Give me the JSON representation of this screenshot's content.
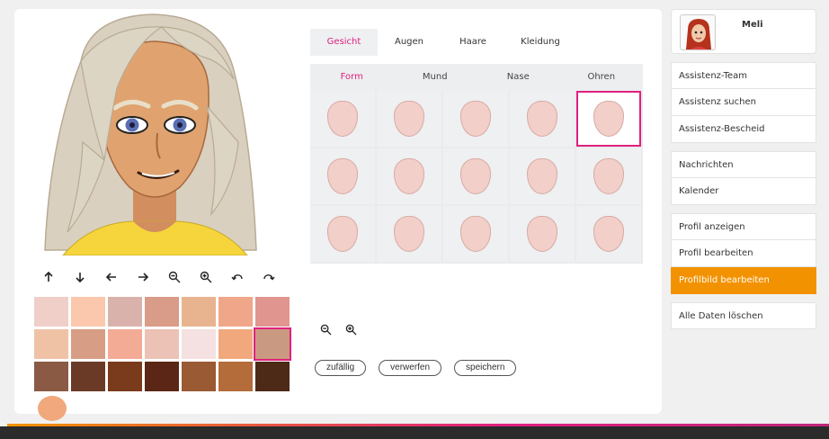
{
  "editor": {
    "tabs": [
      {
        "label": "Gesicht",
        "active": true
      },
      {
        "label": "Augen",
        "active": false
      },
      {
        "label": "Haare",
        "active": false
      },
      {
        "label": "Kleidung",
        "active": false
      }
    ],
    "subtabs": [
      {
        "label": "Form",
        "active": true
      },
      {
        "label": "Mund",
        "active": false
      },
      {
        "label": "Nase",
        "active": false
      },
      {
        "label": "Ohren",
        "active": false
      }
    ],
    "shape_options": 15,
    "selected_shape": 5,
    "actions": {
      "random": "zufällig",
      "discard": "verwerfen",
      "save": "speichern"
    }
  },
  "tools": [
    "arrow-up-icon",
    "arrow-down-icon",
    "arrow-left-icon",
    "arrow-right-icon",
    "zoom-out-icon",
    "zoom-in-icon",
    "undo-icon",
    "redo-icon"
  ],
  "skin_palette": [
    "#f0cfc9",
    "#fbc8ae",
    "#d9b3ab",
    "#d89c89",
    "#e8b48f",
    "#f0a688",
    "#e0968e",
    "#efc2a6",
    "#d79e85",
    "#f3ab95",
    "#ecc2b6",
    "#f5e1e1",
    "#f0a87c",
    "#c99a81",
    "#8a5a44",
    "#6b3a26",
    "#7a3a1c",
    "#5b2615",
    "#9a5a33",
    "#b56c3b",
    "#4d2918"
  ],
  "selected_color": "#c99a81",
  "extra_color": "#f0a87c",
  "sidebar": {
    "user_name": "Meli",
    "groups": [
      [
        "Assistenz-Team",
        "Assistenz suchen",
        "Assistenz-Bescheid"
      ],
      [
        "Nachrichten",
        "Kalender"
      ],
      [
        "Profil anzeigen",
        "Profil bearbeiten",
        "Profilbild bearbeiten"
      ],
      [
        "Alle Daten löschen"
      ]
    ],
    "active_item": "Profilbild bearbeiten"
  }
}
